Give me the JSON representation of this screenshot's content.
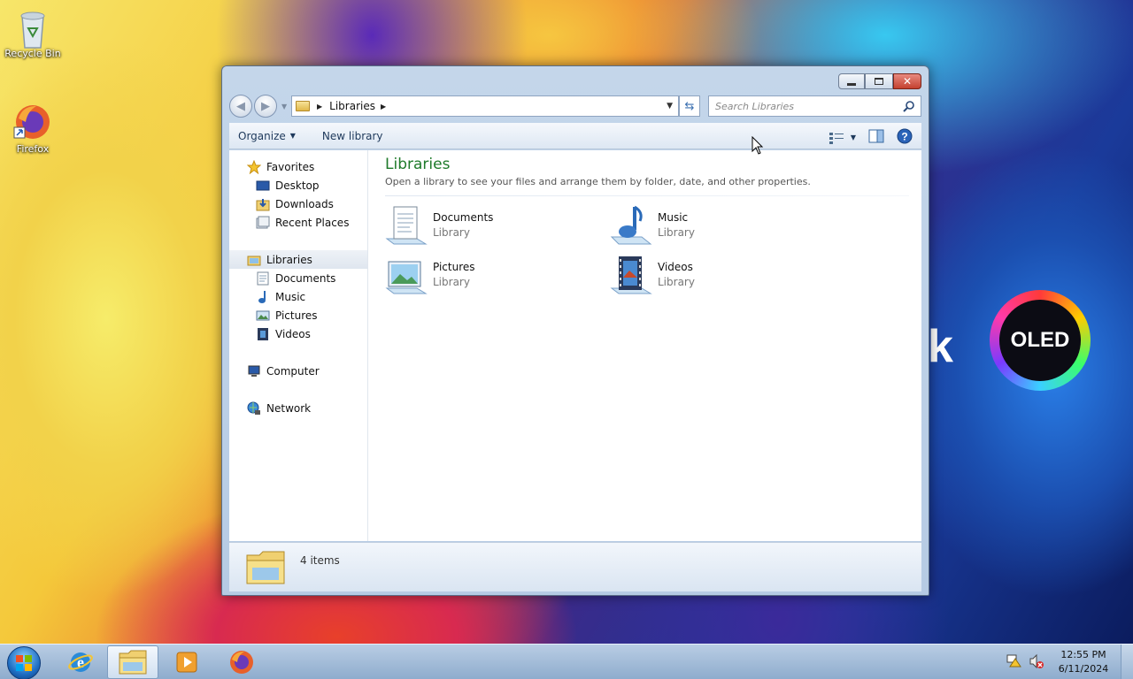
{
  "desktop": {
    "icons": [
      {
        "label": "Recycle Bin",
        "icon": "recycle-bin-icon"
      },
      {
        "label": "Firefox",
        "icon": "firefox-icon"
      }
    ],
    "wallpaper_text": "OLED",
    "wallpaper_letter": "k"
  },
  "window": {
    "title_buttons": {
      "minimize": "minimize-icon",
      "maximize": "maximize-icon",
      "close": "close-icon"
    },
    "address": {
      "crumbs": [
        "Libraries"
      ]
    },
    "search": {
      "placeholder": "Search Libraries"
    },
    "commands": {
      "organize": "Organize",
      "new_library": "New library"
    },
    "nav": {
      "favorites": "Favorites",
      "favorites_items": [
        "Desktop",
        "Downloads",
        "Recent Places"
      ],
      "libraries": "Libraries",
      "libraries_items": [
        "Documents",
        "Music",
        "Pictures",
        "Videos"
      ],
      "computer": "Computer",
      "network": "Network"
    },
    "main": {
      "title": "Libraries",
      "description": "Open a library to see your files and arrange them by folder, date, and other properties.",
      "libraries": [
        {
          "name": "Documents",
          "type": "Library"
        },
        {
          "name": "Music",
          "type": "Library"
        },
        {
          "name": "Pictures",
          "type": "Library"
        },
        {
          "name": "Videos",
          "type": "Library"
        }
      ]
    },
    "details": {
      "count": "4 items"
    }
  },
  "taskbar": {
    "clock": {
      "time": "12:55 PM",
      "date": "6/11/2024"
    },
    "apps": [
      "internet-explorer-icon",
      "windows-explorer-icon",
      "media-player-icon",
      "firefox-icon"
    ]
  },
  "colors": {
    "accent_title": "#1e7a2a",
    "taskbar": "#a3bcd9"
  }
}
